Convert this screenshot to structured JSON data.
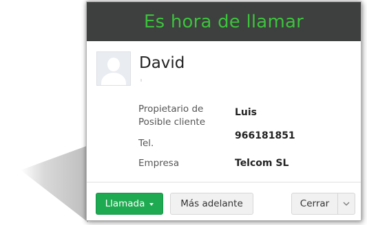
{
  "dialog": {
    "title": "Es hora de llamar",
    "title_color": "#3cc33c",
    "header_bg": "#3e3f3f"
  },
  "contact": {
    "name": "David",
    "avatar_icon": "user-placeholder-icon"
  },
  "fields": {
    "owner_label": "Propietario de Posible cliente",
    "owner_value": "Luis",
    "phone_label": "Tel.",
    "phone_value": "966181851",
    "company_label": "Empresa",
    "company_value": "Telcom SL"
  },
  "actions": {
    "call_label": "Llamada",
    "call_color": "#1eaa50",
    "call_icon": "caret-down-icon",
    "later_label": "Más adelante",
    "close_label": "Cerrar",
    "close_menu_icon": "chevron-down-icon"
  }
}
